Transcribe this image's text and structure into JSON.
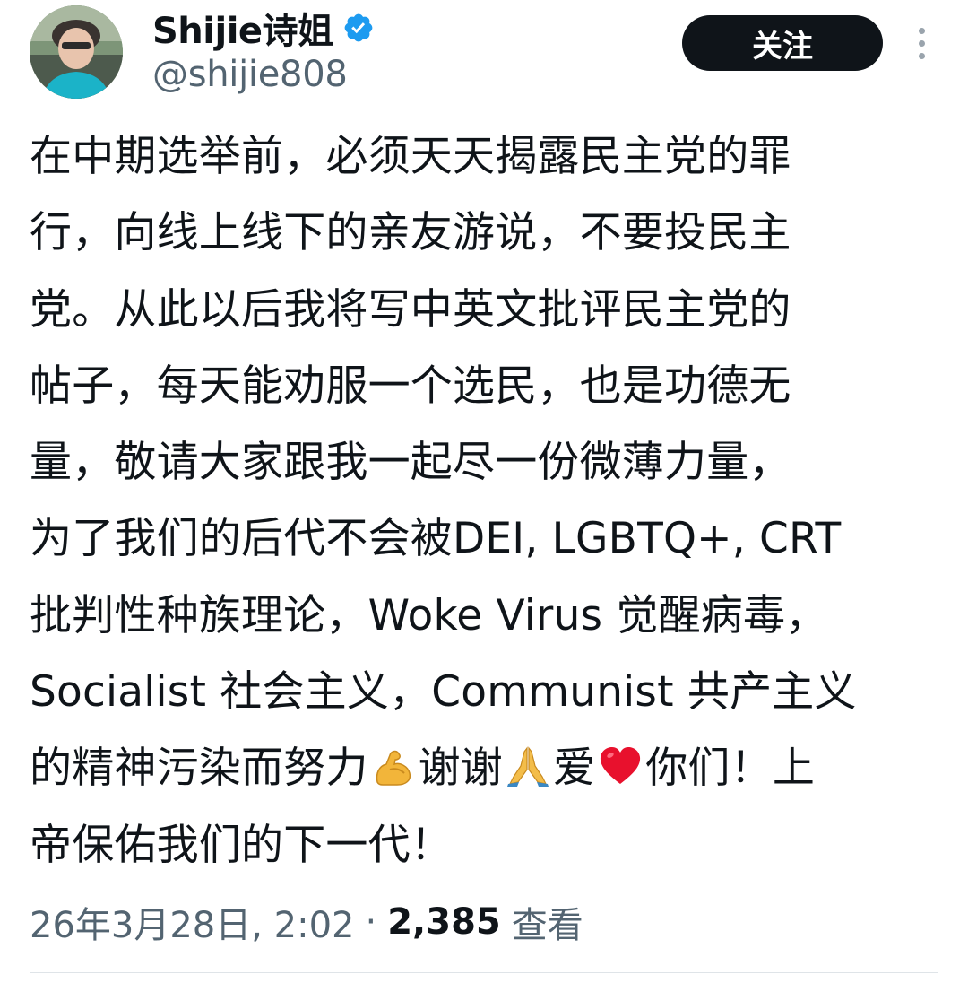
{
  "author": {
    "display_name": "Shijie诗姐",
    "handle": "@shijie808",
    "verified": true
  },
  "follow_button_label": "关注",
  "tweet": {
    "lines": [
      "在中期选举前，必须天天揭露民主党的罪",
      "行，向线上线下的亲友游说，不要投民主",
      "党。从此以后我将写中英文批评民主党的",
      "帖子，每天能劝服一个选民，也是功德无",
      "量，敬请大家跟我一起尽一份微薄力量，",
      "为了我们的后代不会被DEI, LGBTQ+, CRT",
      "批判性种族理论，Woke Virus 觉醒病毒，",
      "Socialist 社会主义，Communist 共产主义"
    ],
    "line9_a": "的精神污染而努力",
    "line9_b": "谢谢",
    "line9_c": "爱",
    "line9_d": "你们！上",
    "line10": "帝保佑我们的下一代！"
  },
  "meta": {
    "timestamp": "26年3月28日, 2:02",
    "separator": "·",
    "views_count": "2,385",
    "views_label": "查看"
  },
  "colors": {
    "text": "#0f1419",
    "secondary": "#536471",
    "verified": "#1d9bf0",
    "button_bg": "#0f1419"
  },
  "icons": [
    "verified-badge-icon",
    "more-options-icon",
    "flexed-biceps-emoji",
    "folded-hands-emoji",
    "red-heart-emoji"
  ]
}
